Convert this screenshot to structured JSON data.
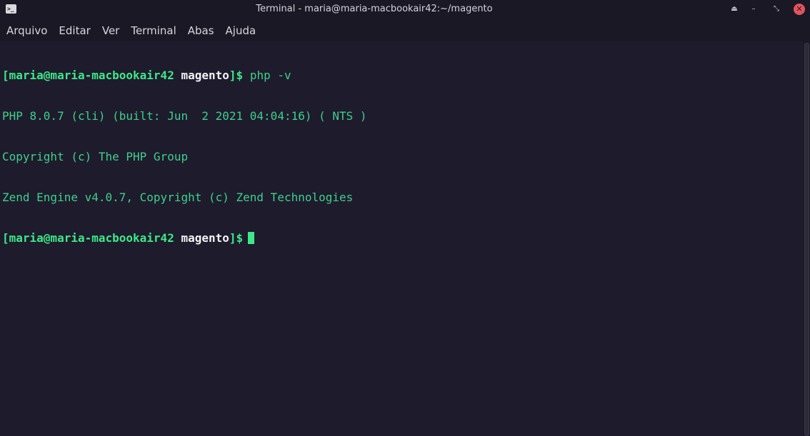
{
  "window": {
    "title": "Terminal - maria@maria-macbookair42:~/magento",
    "app_icon_glyph": ">_",
    "controls": {
      "keep_above": "⏏",
      "minimize": "–",
      "maximize": "⤡",
      "close": "✕"
    }
  },
  "menubar": {
    "items": [
      "Arquivo",
      "Editar",
      "Ver",
      "Terminal",
      "Abas",
      "Ajuda"
    ]
  },
  "terminal": {
    "prompt1": {
      "user": "[maria@maria-macbookair42",
      "dir": "magento",
      "suffix": "]$",
      "command": "php -v"
    },
    "output": [
      "PHP 8.0.7 (cli) (built: Jun  2 2021 04:04:16) ( NTS )",
      "Copyright (c) The PHP Group",
      "Zend Engine v4.0.7, Copyright (c) Zend Technologies"
    ],
    "prompt2": {
      "user": "[maria@maria-macbookair42",
      "dir": "magento",
      "suffix": "]$"
    }
  },
  "colors": {
    "background": "#1e1b2c",
    "prompt_green": "#3ee888",
    "output_green": "#3ed08c",
    "directory_white": "#f2f2f2",
    "close_red": "#e2545d"
  }
}
